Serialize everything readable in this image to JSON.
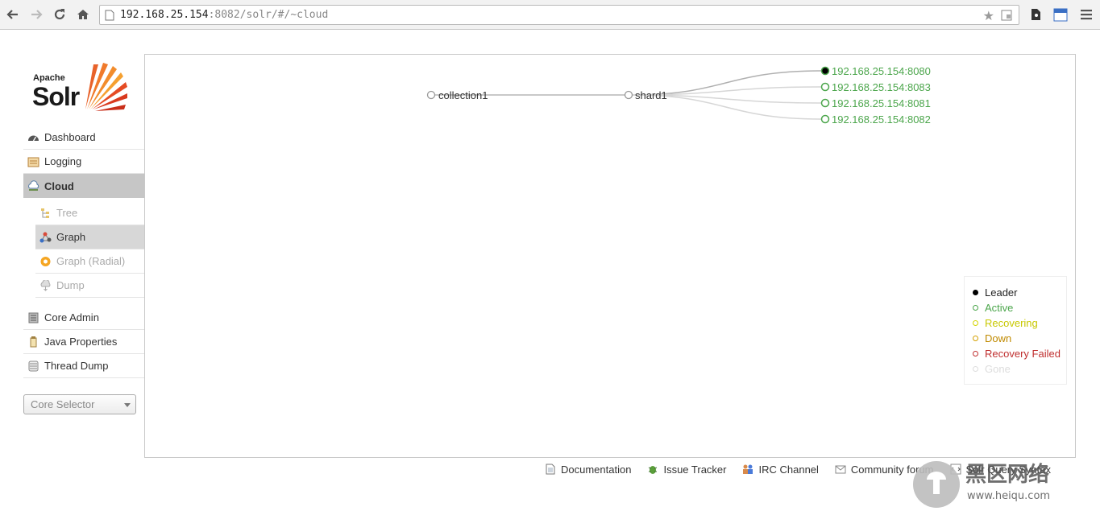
{
  "browser": {
    "url_host": "192.168.25.154",
    "url_rest": ":8082/solr/#/~cloud"
  },
  "logo": {
    "apache": "Apache",
    "solr": "Solr"
  },
  "sidebar": {
    "items": [
      {
        "label": "Dashboard"
      },
      {
        "label": "Logging"
      },
      {
        "label": "Cloud"
      }
    ],
    "cloud_sub": [
      {
        "label": "Tree"
      },
      {
        "label": "Graph"
      },
      {
        "label": "Graph (Radial)"
      },
      {
        "label": "Dump"
      }
    ],
    "items2": [
      {
        "label": "Core Admin"
      },
      {
        "label": "Java Properties"
      },
      {
        "label": "Thread Dump"
      }
    ],
    "core_selector": "Core Selector"
  },
  "graph": {
    "collection": "collection1",
    "shard": "shard1",
    "replicas": [
      {
        "label": "192.168.25.154:8080",
        "state": "leader"
      },
      {
        "label": "192.168.25.154:8083",
        "state": "active"
      },
      {
        "label": "192.168.25.154:8081",
        "state": "active"
      },
      {
        "label": "192.168.25.154:8082",
        "state": "active"
      }
    ]
  },
  "legend": [
    {
      "label": "Leader",
      "color": "#000000"
    },
    {
      "label": "Active",
      "color": "#4ca64c"
    },
    {
      "label": "Recovering",
      "color": "#d4d400"
    },
    {
      "label": "Down",
      "color": "#d4a000"
    },
    {
      "label": "Recovery Failed",
      "color": "#c03030"
    },
    {
      "label": "Gone",
      "color": "#dddddd"
    }
  ],
  "footer": [
    {
      "label": "Documentation"
    },
    {
      "label": "Issue Tracker"
    },
    {
      "label": "IRC Channel"
    },
    {
      "label": "Community forum"
    },
    {
      "label": "Solr Query Syntax"
    }
  ],
  "watermark": {
    "cn": "黑区网络",
    "url": "www.heiqu.com"
  }
}
